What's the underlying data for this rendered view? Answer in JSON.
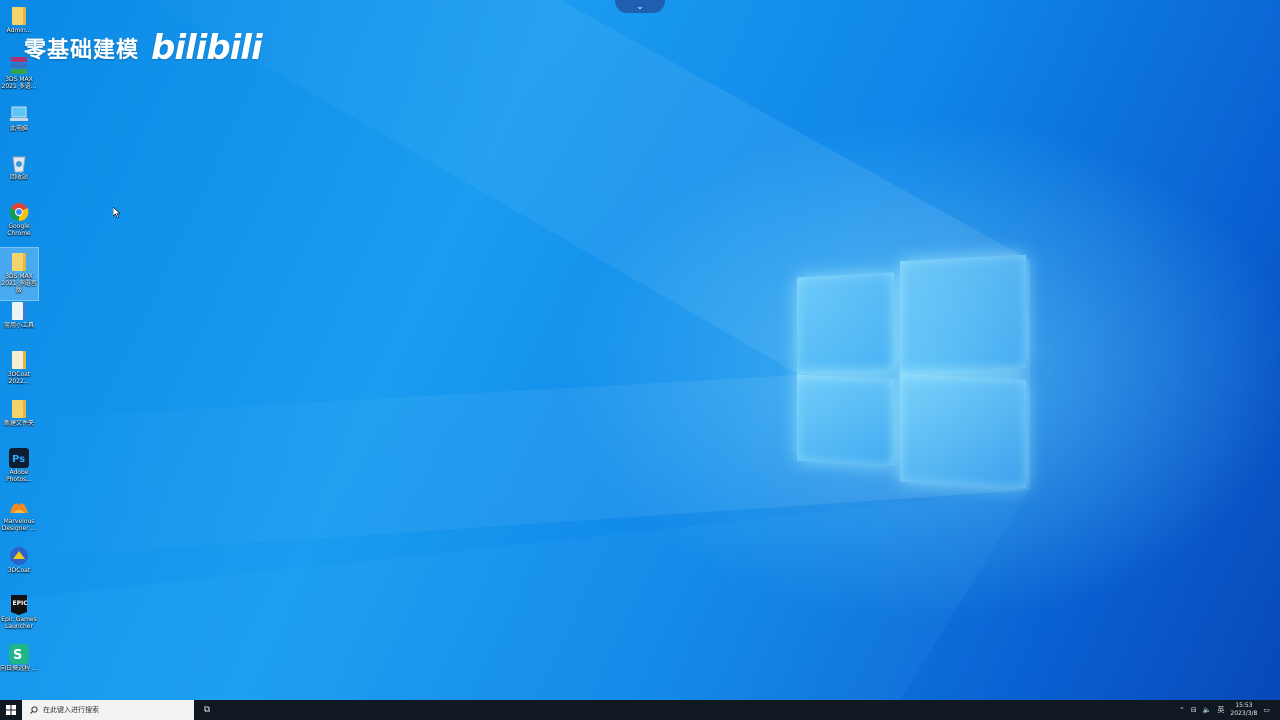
{
  "watermark": {
    "channel_text": "零基础建模",
    "logo_text": "bilibili"
  },
  "desktop_icons": [
    {
      "label": "Admin...",
      "icon": "user-folder-icon"
    },
    {
      "label": "3DS MAX 2021 多语...",
      "icon": "winrar-icon"
    },
    {
      "label": "此电脑",
      "icon": "computer-icon"
    },
    {
      "label": "回收站",
      "icon": "recycle-bin-icon"
    },
    {
      "label": "Google Chrome",
      "icon": "chrome-icon"
    },
    {
      "label": "3DS MAX 2021 多语言版",
      "icon": "folder-icon"
    },
    {
      "label": "常用小工具",
      "icon": "file-icon"
    },
    {
      "label": "3DCoat 2022...",
      "icon": "file-icon"
    },
    {
      "label": "新建文件夹",
      "icon": "folder-icon"
    },
    {
      "label": "Adobe Photos...",
      "icon": "photoshop-icon"
    },
    {
      "label": "Marvelous Designer ...",
      "icon": "marvelous-designer-icon"
    },
    {
      "label": "3DCoat",
      "icon": "3dcoat-icon"
    },
    {
      "label": "Epic Games Launcher",
      "icon": "epic-games-icon"
    },
    {
      "label": "向日葵远程 ...",
      "icon": "sunlogin-icon"
    }
  ],
  "taskbar": {
    "search_placeholder": "在此键入进行搜索",
    "task_view_label": "⧉",
    "tray": {
      "input_method": "英",
      "time": "15:53",
      "date": "2023/3/8"
    }
  },
  "colors": {
    "taskbar": "#101822",
    "desktop_accent": "#1a9cf0"
  }
}
